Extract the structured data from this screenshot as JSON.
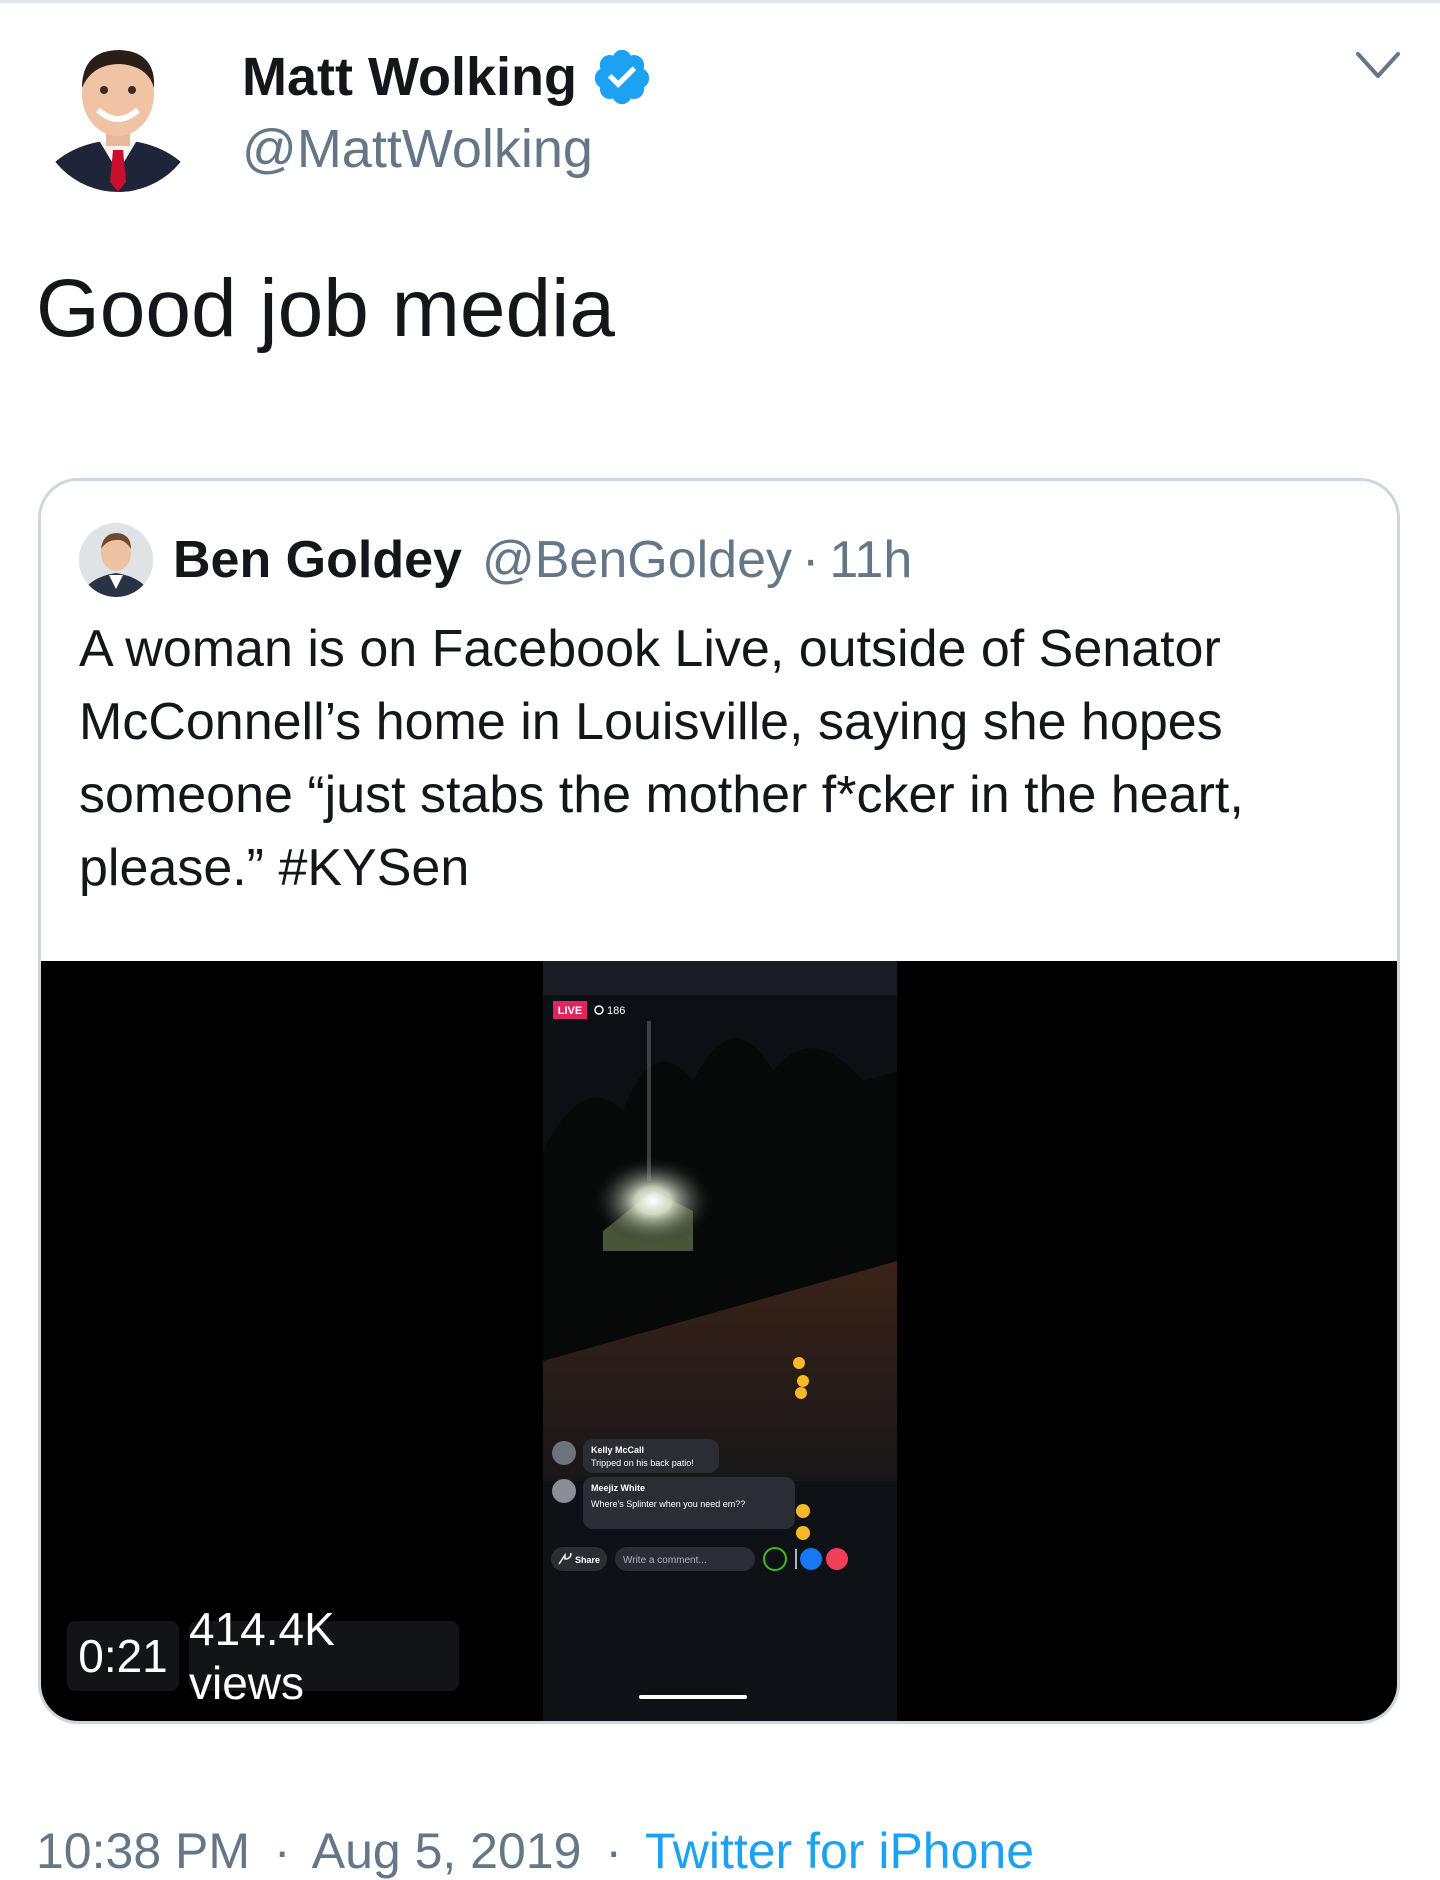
{
  "author": {
    "name": "Matt Wolking",
    "handle": "@MattWolking",
    "verified": true,
    "verified_icon": "verified-badge-icon",
    "verified_color": "#1da1f2"
  },
  "tweet": {
    "text": "Good job media"
  },
  "quoted": {
    "name": "Ben Goldey",
    "handle": "@BenGoldey",
    "separator": "·",
    "time": "11h",
    "text": "A woman is on Facebook Live, outside of Senator McConnell’s home in Louisville, saying she hopes someone “just stabs the mother f*cker in the heart, please.” #KYSen",
    "video": {
      "duration": "0:21",
      "views": "414.4K views",
      "live_badge": "LIVE",
      "viewer_count": "186",
      "comments": [
        {
          "name": "Kelly McCall",
          "text": "Tripped on his back patio!"
        },
        {
          "name": "Meejiz White",
          "text": "Where's Splinter when you need em??"
        }
      ],
      "share_label": "Share",
      "comment_placeholder": "Write a comment..."
    }
  },
  "footer": {
    "time": "10:38 PM",
    "separator": "·",
    "date": "Aug 5, 2019",
    "source": "Twitter for iPhone"
  },
  "colors": {
    "link": "#1da1f2",
    "secondary_text": "#657786",
    "border": "#ccd6dd"
  }
}
